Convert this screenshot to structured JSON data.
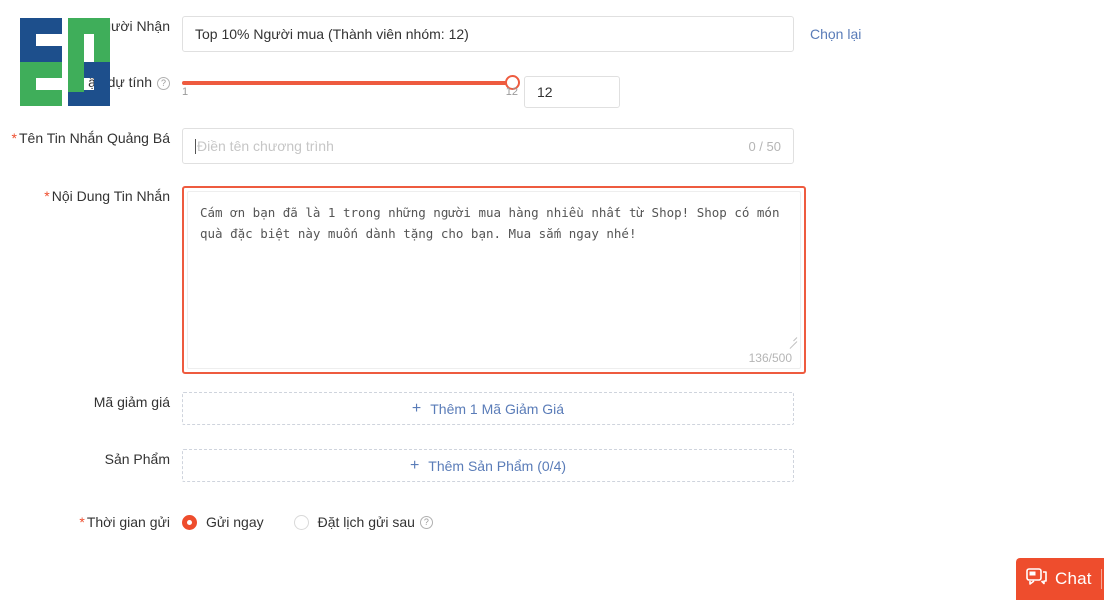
{
  "watermark": {
    "name": "site-watermark-logo",
    "colors": {
      "blue": "#1d4f8c",
      "green": "#3fae5a"
    }
  },
  "theme": {
    "accent": "#ee4d2d",
    "slider": "#ee5b3f",
    "link": "#5a7cb8",
    "border": "#e0e0e0"
  },
  "rows": {
    "recipient": {
      "label": "a Người Nhận",
      "value": "Top 10% Người mua (Thành viên nhóm: 12)",
      "reselect_label": "Chọn lại"
    },
    "estimate": {
      "label": "ận dự tính",
      "help_icon": "question-circle-icon",
      "slider_min_label": "1",
      "slider_max_label": "12",
      "slider_value": "12",
      "number_value": "12"
    },
    "campaign_name": {
      "label": "Tên Tin Nhắn Quảng Bá",
      "required": "*",
      "placeholder": "Điền tên chương trình",
      "counter": "0 / 50"
    },
    "message_content": {
      "label": "Nội Dung Tin Nhắn",
      "required": "*",
      "value": "Cám ơn bạn đã là 1 trong những người mua hàng nhiều nhất từ Shop! Shop có món quà đặc biệt này muốn dành tặng cho bạn. Mua sắm ngay nhé!",
      "counter": "136/500"
    },
    "voucher": {
      "label": "Mã giảm giá",
      "button_label": "Thêm 1 Mã Giảm Giá",
      "plus_icon": "plus-icon"
    },
    "product": {
      "label": "Sản Phẩm",
      "button_label": "Thêm Sản Phẩm (0/4)",
      "plus_icon": "plus-icon"
    },
    "send_time": {
      "label": "Thời gian gửi",
      "required": "*",
      "options": [
        {
          "label": "Gửi ngay",
          "selected": true
        },
        {
          "label": "Đặt lịch gửi sau",
          "selected": false,
          "help_icon": "question-circle-icon"
        }
      ]
    }
  },
  "chat_widget": {
    "label": "Chat",
    "icon": "chat-bubble-icon"
  }
}
